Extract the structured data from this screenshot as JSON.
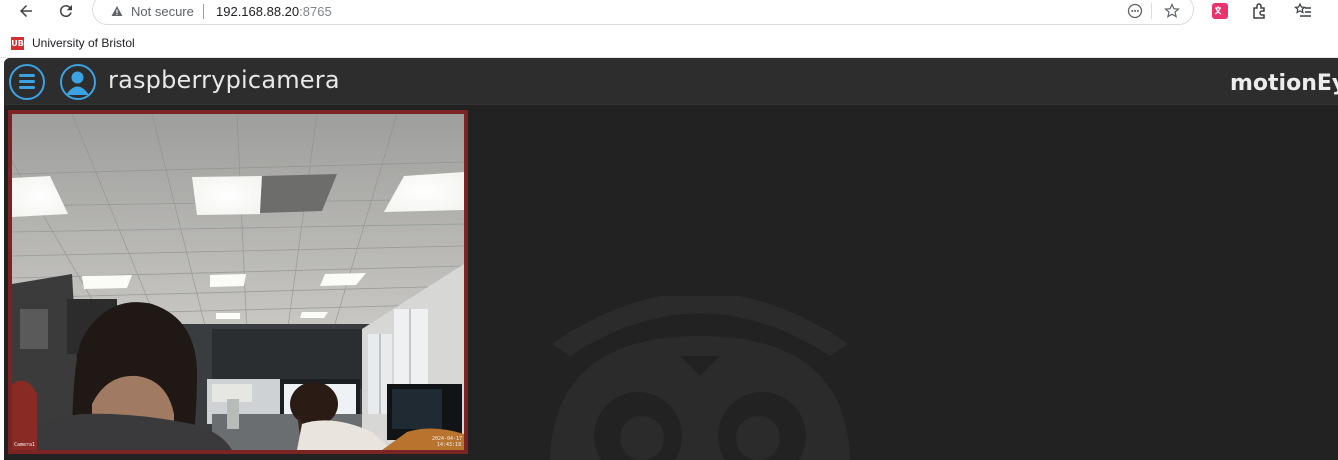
{
  "browser": {
    "security_label": "Not secure",
    "url_host": "192.168.88.20",
    "url_port": ":8765",
    "bookmarks": [
      {
        "label": "University of Bristol",
        "favicon_text": "UB"
      }
    ],
    "icons": [
      "back-icon",
      "reload-icon",
      "warning-icon",
      "translate-icon",
      "star-icon",
      "extension-icon",
      "puzzle-icon",
      "favorites-icon"
    ]
  },
  "app": {
    "camera_name": "raspberrypicamera",
    "brand": "motionEye",
    "accent_color": "#3ba3e3",
    "frame_border_color": "#7a2424",
    "camera": {
      "overlay_left": "Camera1",
      "overlay_date": "2024-04-17",
      "overlay_time": "14:43:18"
    }
  }
}
